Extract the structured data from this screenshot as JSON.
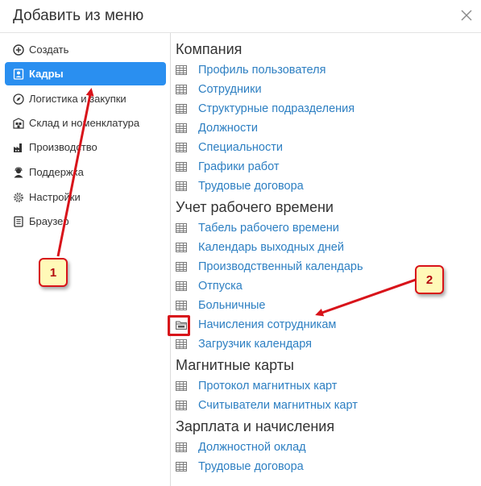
{
  "dialog": {
    "title": "Добавить из меню"
  },
  "sidebar": {
    "items": [
      {
        "label": "Создать",
        "icon": "plus-circle-icon",
        "active": false
      },
      {
        "label": "Кадры",
        "icon": "id-badge-icon",
        "active": true
      },
      {
        "label": "Логистика и закупки",
        "icon": "compass-icon",
        "active": false
      },
      {
        "label": "Склад и номенклатура",
        "icon": "warehouse-icon",
        "active": false
      },
      {
        "label": "Производство",
        "icon": "factory-icon",
        "active": false
      },
      {
        "label": "Поддержка",
        "icon": "support-agent-icon",
        "active": false
      },
      {
        "label": "Настройки",
        "icon": "gear-icon",
        "active": false
      },
      {
        "label": "Браузер",
        "icon": "document-icon",
        "active": false
      }
    ]
  },
  "main": {
    "sections": [
      {
        "title": "Компания",
        "items": [
          "Профиль пользователя",
          "Сотрудники",
          "Структурные подразделения",
          "Должности",
          "Специальности",
          "Графики работ",
          "Трудовые договора"
        ]
      },
      {
        "title": "Учет рабочего времени",
        "items": [
          "Табель рабочего времени",
          "Календарь выходных дней",
          "Производственный календарь",
          "Отпуска",
          "Больничные",
          "Начисления сотрудникам",
          "Загрузчик календаря"
        ]
      },
      {
        "title": "Магнитные карты",
        "items": [
          "Протокол магнитных карт",
          "Считыватели магнитных карт"
        ]
      },
      {
        "title": "Зарплата и начисления",
        "items": [
          "Должностной оклад",
          "Трудовые договора"
        ]
      }
    ]
  },
  "annotations": {
    "callout_1": "1",
    "callout_2": "2"
  },
  "colors": {
    "accent": "#2a8ff0",
    "link": "#2d7fc2",
    "annotation_red": "#d8131a",
    "callout_fill": "#fff9b8"
  }
}
